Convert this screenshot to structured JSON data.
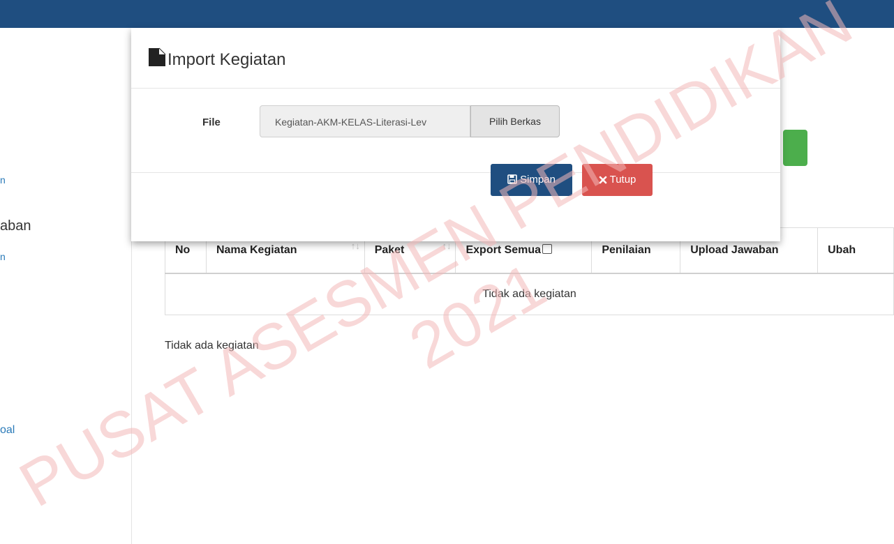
{
  "sidebar": {
    "fragments": [
      "n",
      "aban",
      "n",
      "oal"
    ]
  },
  "modal": {
    "title": "Import Kegiatan",
    "file_label": "File",
    "file_value": "Kegiatan-AKM-KELAS-Literasi-Lev",
    "browse_label": "Pilih Berkas",
    "save_label": "Simpan",
    "close_label": "Tutup"
  },
  "table": {
    "headers": [
      "No",
      "Nama Kegiatan",
      "Paket",
      "Export Semua",
      "Penilaian",
      "Upload Jawaban",
      "Ubah"
    ],
    "empty_text": "Tidak ada kegiatan"
  },
  "empty_message": "Tidak ada kegiatan",
  "watermark": {
    "line1": "PUSAT ASESMEN PENDIDIKAN",
    "line2": "2021"
  },
  "colors": {
    "topbar": "#1f4e80",
    "primary": "#1f4e80",
    "danger": "#d9534f",
    "success": "#4cae4c",
    "watermark": "#f3b8b8"
  },
  "icons": {
    "title": "file-icon",
    "save": "floppy-disk-icon",
    "close": "times-icon"
  }
}
